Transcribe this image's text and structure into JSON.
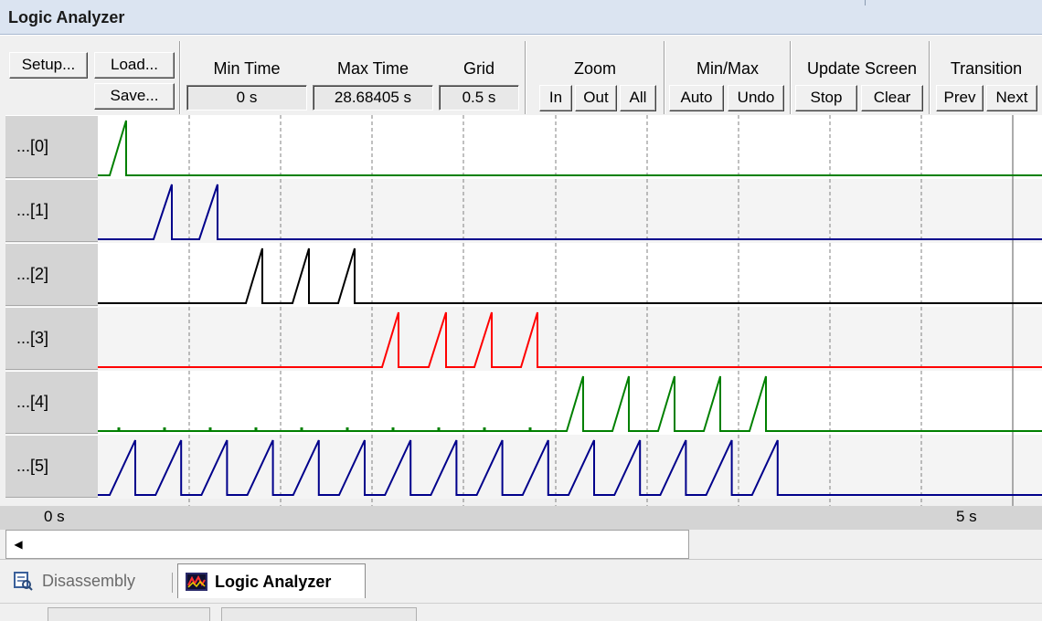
{
  "window": {
    "title": "Logic Analyzer"
  },
  "toolbar": {
    "setup_label": "Setup...",
    "load_label": "Load...",
    "save_label": "Save...",
    "min_time_label": "Min Time",
    "min_time_value": "0 s",
    "max_time_label": "Max Time",
    "max_time_value": "28.68405 s",
    "grid_label": "Grid",
    "grid_value": "0.5 s",
    "zoom_label": "Zoom",
    "zoom_in": "In",
    "zoom_out": "Out",
    "zoom_all": "All",
    "minmax_label": "Min/Max",
    "minmax_auto": "Auto",
    "minmax_undo": "Undo",
    "update_label": "Update Screen",
    "update_stop": "Stop",
    "update_clear": "Clear",
    "transition_label": "Transition",
    "transition_prev": "Prev",
    "transition_next": "Next"
  },
  "signals": [
    {
      "label": "...[0]",
      "color": "#008000"
    },
    {
      "label": "...[1]",
      "color": "#00008b"
    },
    {
      "label": "...[2]",
      "color": "#000000"
    },
    {
      "label": "...[3]",
      "color": "#ff0000"
    },
    {
      "label": "...[4]",
      "color": "#008000"
    },
    {
      "label": "...[5]",
      "color": "#00008b"
    }
  ],
  "axis": {
    "start_label": "0 s",
    "end_label": "5 s"
  },
  "tabs": [
    {
      "label": "Disassembly",
      "icon": "disassembly-icon",
      "active": false
    },
    {
      "label": "Logic Analyzer",
      "icon": "logic-analyzer-icon",
      "active": true
    }
  ]
}
